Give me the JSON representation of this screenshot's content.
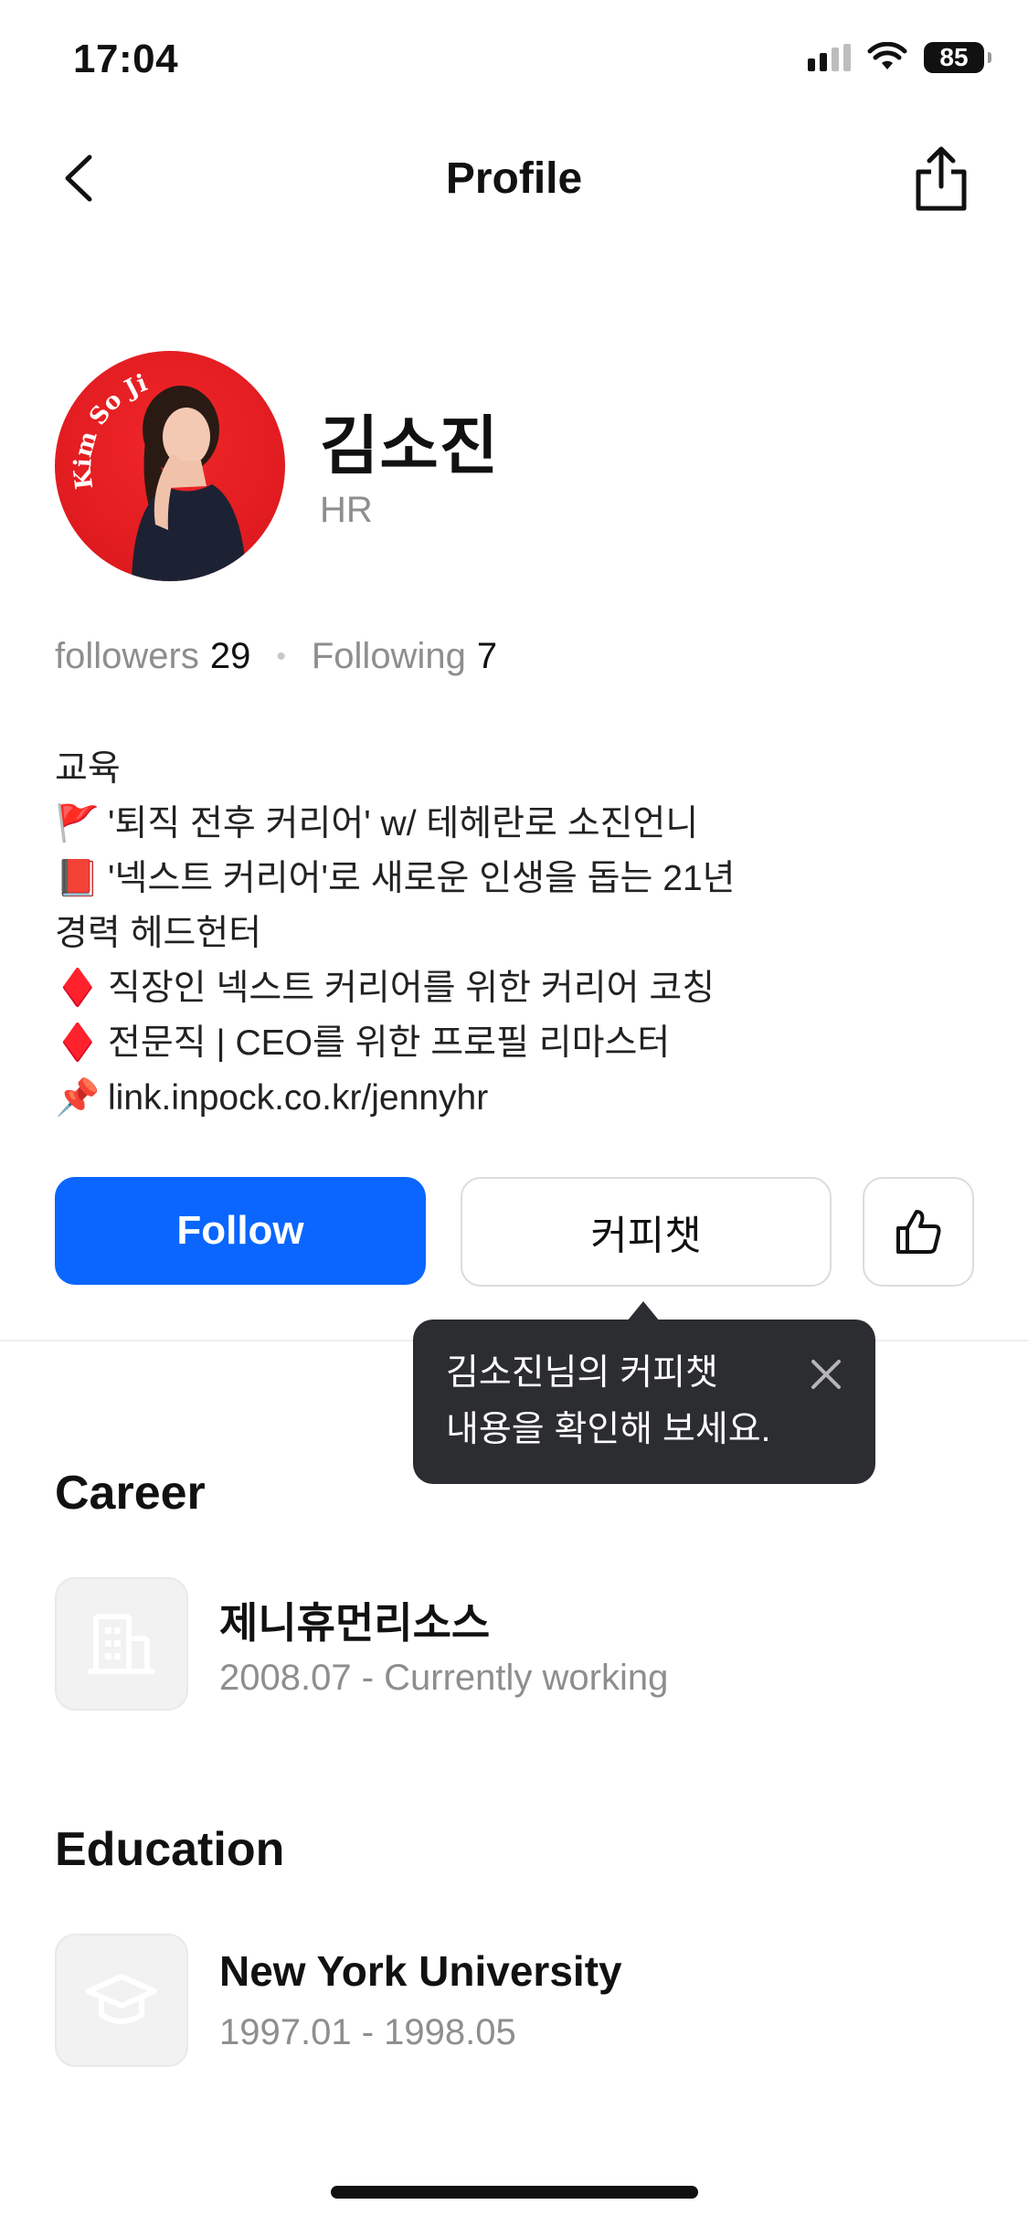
{
  "status_bar": {
    "time": "17:04",
    "battery": "85"
  },
  "header": {
    "title": "Profile"
  },
  "profile": {
    "name": "김소진",
    "role": "HR",
    "avatar_text": "Kim So Jin"
  },
  "stats": {
    "followers_label": "followers",
    "followers_count": "29",
    "following_label": "Following",
    "following_count": "7"
  },
  "bio": {
    "lines": [
      {
        "icon": "",
        "text": "교육"
      },
      {
        "icon": "🚩",
        "text": "'퇴직 전후 커리어' w/ 테헤란로 소진언니"
      },
      {
        "icon": "📕",
        "text": "'넥스트 커리어'로 새로운 인생을 돕는 21년"
      },
      {
        "icon": "",
        "text": "경력 헤드헌터"
      },
      {
        "icon": "♦️",
        "text": "직장인 넥스트 커리어를 위한 커리어 코칭"
      },
      {
        "icon": "♦️",
        "text": "전문직 | CEO를 위한 프로필 리마스터"
      },
      {
        "icon": "📌",
        "text": "link.inpock.co.kr/jennyhr"
      }
    ]
  },
  "actions": {
    "follow_label": "Follow",
    "chat_label": "커피챗"
  },
  "tooltip": {
    "line1": "김소진님의 커피챗",
    "line2": "내용을 확인해 보세요."
  },
  "career": {
    "title": "Career",
    "company": "제니휴먼리소스",
    "period": "2008.07 - Currently working"
  },
  "education": {
    "title": "Education",
    "school": "New York University",
    "period": "1997.01 - 1998.05"
  },
  "colors": {
    "accent": "#0a66ff",
    "avatar_bg": "#e01b1f",
    "tooltip_bg": "#2c2d30",
    "muted_text": "#8e8e8e"
  }
}
